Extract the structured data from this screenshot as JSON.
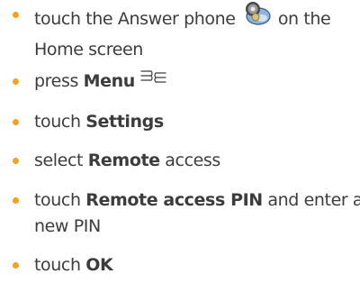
{
  "steps": [
    {
      "prefix": "touch the Answer phone ",
      "icon": "answer-phone-icon",
      "suffix": " on the",
      "line2": "Home screen"
    },
    {
      "prefix": "press ",
      "bold": "Menu",
      "icon": "menu-icon"
    },
    {
      "prefix": "touch ",
      "bold": "Settings"
    },
    {
      "prefix": "select ",
      "bold": "Remote",
      "suffix": " access"
    },
    {
      "prefix": "touch ",
      "bold": "Remote access PIN",
      "suffix": " and enter a",
      "line2": "new PIN"
    },
    {
      "prefix": "touch ",
      "bold": "OK"
    }
  ],
  "colors": {
    "bullet": "#f3a21c",
    "text": "#3c3c3c"
  }
}
